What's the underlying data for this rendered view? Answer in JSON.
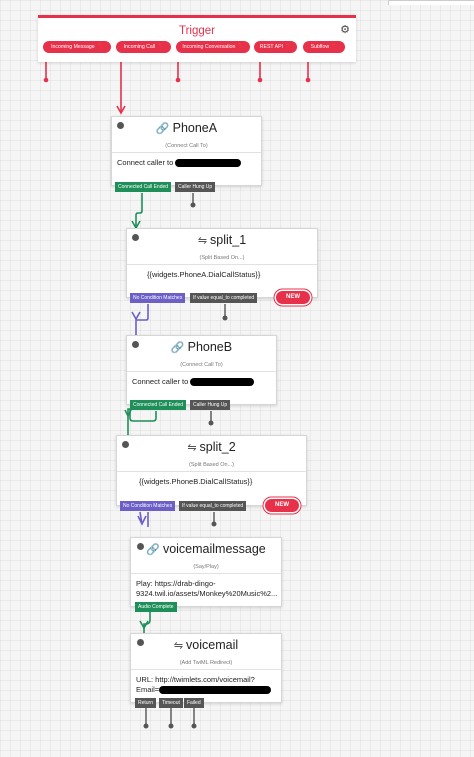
{
  "trigger": {
    "title": "Trigger",
    "pills": [
      {
        "label": "Incoming Message"
      },
      {
        "label": "Incoming Call"
      },
      {
        "label": "Incoming Conversation"
      },
      {
        "label": "REST API"
      },
      {
        "label": "Subflow"
      }
    ]
  },
  "widgets": {
    "phoneA": {
      "title": "PhoneA",
      "subtitle": "(Connect Call To)",
      "body": "Connect caller to",
      "transitions": [
        "Connected Call Ended",
        "Caller Hung Up"
      ]
    },
    "split1": {
      "title": "split_1",
      "subtitle": "(Split Based On...)",
      "body": "{{widgets.PhoneA.DialCallStatus}}",
      "transitions": [
        "No Condition Matches",
        "If value equal_to completed"
      ],
      "new_badge": "NEW"
    },
    "phoneB": {
      "title": "PhoneB",
      "subtitle": "(Connect Call To)",
      "body": "Connect caller to",
      "transitions": [
        "Connected Call Ended",
        "Caller Hung Up"
      ]
    },
    "split2": {
      "title": "split_2",
      "subtitle": "(Split Based On...)",
      "body": "{{widgets.PhoneB.DialCallStatus}}",
      "transitions": [
        "No Condition Matches",
        "If value equal_to completed"
      ],
      "new_badge": "NEW"
    },
    "voicemailmessage": {
      "title": "voicemailmessage",
      "subtitle": "(Say/Play)",
      "body_line1": "Play: https://drab-dingo-",
      "body_line2": "9324.twil.io/assets/Monkey%20Music%2...",
      "transitions": [
        "Audio Complete"
      ]
    },
    "voicemail": {
      "title": "voicemail",
      "subtitle": "(Add TwiML Redirect)",
      "body_line1": "URL: http://twimlets.com/voicemail?",
      "body_line2": "Email=",
      "transitions": [
        "Return",
        "Timeout",
        "Failed"
      ]
    }
  },
  "colors": {
    "accent": "#e7314b",
    "green": "#1f8f5a",
    "purple": "#6c5fc7",
    "gray": "#555555"
  },
  "icons": {
    "trigger_settings": "gears-icon",
    "connect": "phone-link-icon",
    "split": "split-icon",
    "say": "speaker-icon",
    "twiml": "split-icon"
  }
}
